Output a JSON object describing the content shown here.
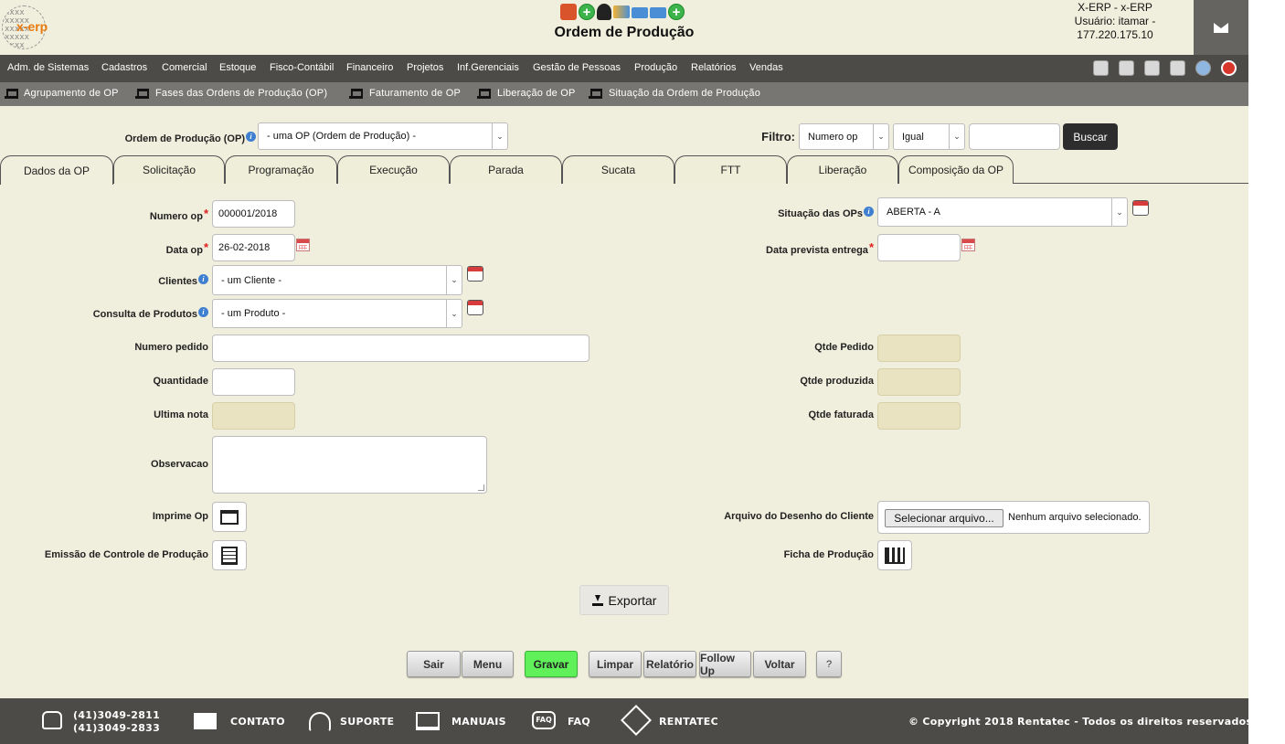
{
  "header": {
    "logo_text": "x-erp",
    "title": "Ordem de Produção",
    "user_line1": "X-ERP - x-ERP",
    "user_line2": "Usuário: itamar -",
    "user_line3": "177.220.175.10"
  },
  "main_nav": [
    "Adm. de Sistemas",
    "Cadastros",
    "Comercial",
    "Estoque",
    "Fisco-Contábil",
    "Financeiro",
    "Projetos",
    "Inf.Gerenciais",
    "Gestão de Pessoas",
    "Produção",
    "Relatórios",
    "Vendas"
  ],
  "sub_nav": [
    "Agrupamento de OP",
    "Fases das Ordens de Produção (OP)",
    "Faturamento de OP",
    "Liberação de OP",
    "Situação da Ordem de Produção"
  ],
  "filter": {
    "op_label": "Ordem de Produção (OP)",
    "op_selected": "- uma OP (Ordem de Produção) -",
    "filtro_label": "Filtro:",
    "field_selected": "Numero op",
    "operator_selected": "Igual",
    "search_value": "",
    "search_button": "Buscar"
  },
  "tabs": [
    "Dados da OP",
    "Solicitação",
    "Programação",
    "Execução",
    "Parada",
    "Sucata",
    "FTT",
    "Liberação",
    "Composição da OP"
  ],
  "form": {
    "numero_op_label": "Numero op",
    "numero_op_value": "000001/2018",
    "data_op_label": "Data op",
    "data_op_value": "26-02-2018",
    "clientes_label": "Clientes",
    "clientes_selected": "- um Cliente -",
    "produtos_label": "Consulta de Produtos",
    "produtos_selected": "- um Produto -",
    "numero_pedido_label": "Numero pedido",
    "numero_pedido_value": "",
    "quantidade_label": "Quantidade",
    "quantidade_value": "",
    "ultima_nota_label": "Ultima nota",
    "ultima_nota_value": "",
    "observacao_label": "Observacao",
    "imprime_op_label": "Imprime Op",
    "emissao_label": "Emissão de Controle de Produção",
    "situacao_label": "Situação das OPs",
    "situacao_selected": "ABERTA - A",
    "data_prevista_label": "Data prevista entrega",
    "data_prevista_value": "",
    "qtde_pedido_label": "Qtde Pedido",
    "qtde_produzida_label": "Qtde produzida",
    "qtde_faturada_label": "Qtde faturada",
    "arquivo_label": "Arquivo do Desenho do Cliente",
    "file_button": "Selecionar arquivo...",
    "file_status": "Nenhum arquivo selecionado.",
    "ficha_label": "Ficha de Produção"
  },
  "export_label": "Exportar",
  "buttons": [
    "Sair",
    "Menu",
    "Gravar",
    "Limpar",
    "Relatório",
    "Follow Up",
    "Voltar",
    "?"
  ],
  "footer": {
    "phone1": "(41)3049-2811",
    "phone2": "(41)3049-2833",
    "contato": "CONTATO",
    "suporte": "SUPORTE",
    "manuais": "MANUAIS",
    "faq": "FAQ",
    "faq_icon_text": "FAQ",
    "rentatec": "RENTATEC",
    "copyright": "© Copyright 2018 Rentatec - Todos os direitos reservados"
  },
  "colors": {
    "background": "#f0eedc",
    "nav": "#4d4b47",
    "subnav": "#787673",
    "save_button": "#5ff05a"
  }
}
